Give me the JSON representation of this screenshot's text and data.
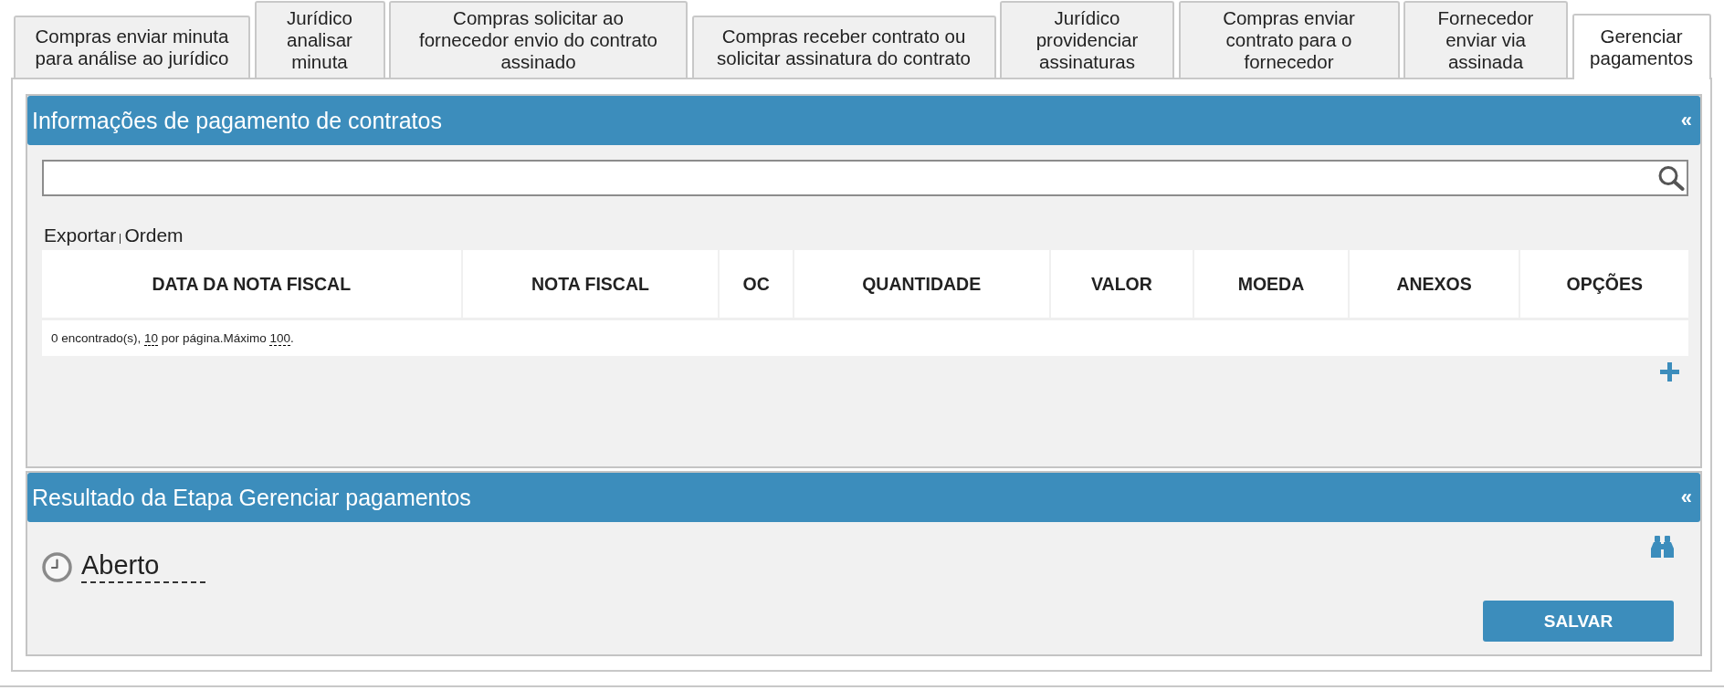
{
  "tabs": [
    {
      "label": "Compras enviar minuta para análise ao jurídico",
      "selected": false
    },
    {
      "label": "Jurídico analisar minuta",
      "selected": false
    },
    {
      "label": "Compras solicitar ao fornecedor envio do contrato assinado",
      "selected": false
    },
    {
      "label": "Compras receber contrato ou solicitar assinatura do contrato",
      "selected": false
    },
    {
      "label": "Jurídico providenciar assinaturas",
      "selected": false
    },
    {
      "label": "Compras enviar contrato para o fornecedor",
      "selected": false
    },
    {
      "label": "Fornecedor enviar via assinada",
      "selected": false
    },
    {
      "label": "Gerenciar pagamentos",
      "selected": true
    }
  ],
  "payments_panel": {
    "title": "Informações de pagamento de contratos",
    "collapse": "«",
    "actions": [
      "Exportar",
      "Ordem"
    ],
    "table": {
      "columns": [
        "DATA DA NOTA FISCAL",
        "NOTA FISCAL",
        "OC",
        "QUANTIDADE",
        "VALOR",
        "MOEDA",
        "ANEXOS",
        "OPÇÕES"
      ]
    },
    "pagination": [
      {
        "kind": "text",
        "text": "0 encontrado(s), "
      },
      {
        "kind": "link",
        "text": "10"
      },
      {
        "kind": "text",
        "text": " por página.Máximo "
      },
      {
        "kind": "link",
        "text": "100"
      },
      {
        "kind": "text",
        "text": "."
      }
    ]
  },
  "result_panel": {
    "title": "Resultado da Etapa Gerenciar pagamentos",
    "collapse": "«",
    "status": "Aberto",
    "save_button": "SALVAR"
  }
}
